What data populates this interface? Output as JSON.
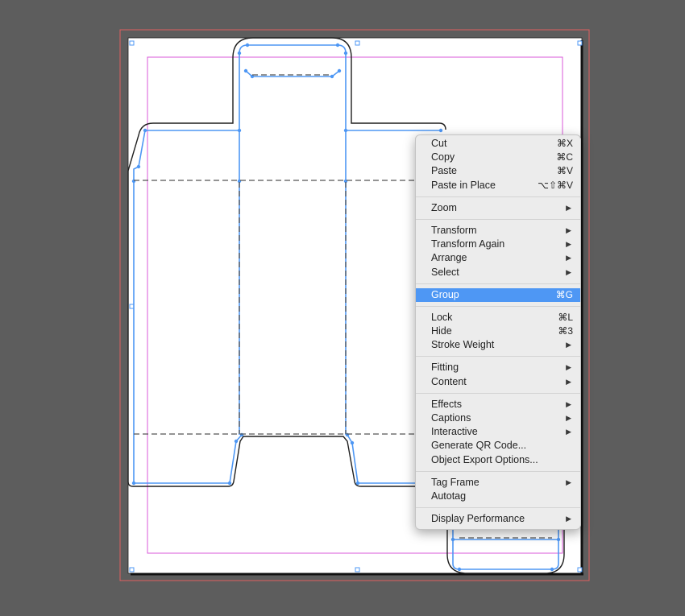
{
  "colors": {
    "pasteboard": "#5d5d5d",
    "page": "#ffffff",
    "bleed_guide": "#e06060",
    "margin_guide": "#d957d9",
    "frame_selection": "#4e97f4",
    "dieline": "#1f1f1f",
    "menu_background": "#ececec",
    "menu_highlight": "#4e97f4"
  },
  "context_menu": {
    "groups": [
      [
        {
          "label": "Cut",
          "shortcut": "⌘X"
        },
        {
          "label": "Copy",
          "shortcut": "⌘C"
        },
        {
          "label": "Paste",
          "shortcut": "⌘V"
        },
        {
          "label": "Paste in Place",
          "shortcut": "⌥⇧⌘V"
        }
      ],
      [
        {
          "label": "Zoom",
          "submenu": true
        }
      ],
      [
        {
          "label": "Transform",
          "submenu": true
        },
        {
          "label": "Transform Again",
          "submenu": true
        },
        {
          "label": "Arrange",
          "submenu": true
        },
        {
          "label": "Select",
          "submenu": true
        }
      ],
      [
        {
          "label": "Group",
          "shortcut": "⌘G",
          "highlighted": true
        }
      ],
      [
        {
          "label": "Lock",
          "shortcut": "⌘L"
        },
        {
          "label": "Hide",
          "shortcut": "⌘3"
        },
        {
          "label": "Stroke Weight",
          "submenu": true
        }
      ],
      [
        {
          "label": "Fitting",
          "submenu": true
        },
        {
          "label": "Content",
          "submenu": true
        }
      ],
      [
        {
          "label": "Effects",
          "submenu": true
        },
        {
          "label": "Captions",
          "submenu": true
        },
        {
          "label": "Interactive",
          "submenu": true
        },
        {
          "label": "Generate QR Code..."
        },
        {
          "label": "Object Export Options..."
        }
      ],
      [
        {
          "label": "Tag Frame",
          "submenu": true
        },
        {
          "label": "Autotag"
        }
      ],
      [
        {
          "label": "Display Performance",
          "submenu": true
        }
      ]
    ]
  }
}
